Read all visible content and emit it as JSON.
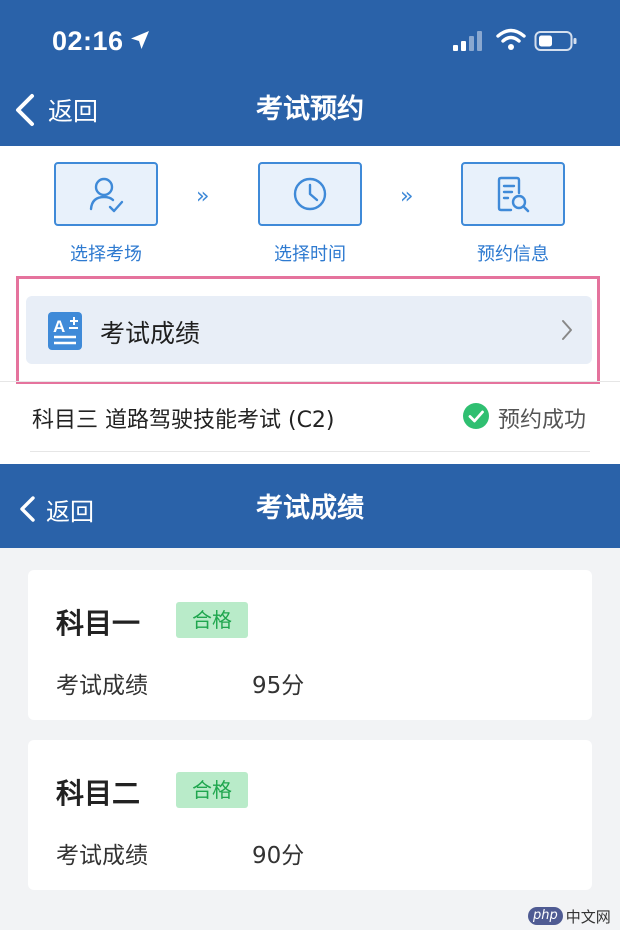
{
  "status_bar": {
    "time": "02:16"
  },
  "nav1": {
    "back_label": "返回",
    "title": "考试预约"
  },
  "steps": [
    {
      "label": "选择考场",
      "icon": "user-check-icon"
    },
    {
      "label": "选择时间",
      "icon": "clock-icon"
    },
    {
      "label": "预约信息",
      "icon": "document-search-icon"
    }
  ],
  "step_separator": "»",
  "score_entry": {
    "label": "考试成绩",
    "icon": "grade-a-plus-icon"
  },
  "exam": {
    "name": "科目三 道路驾驶技能考试 (C2)",
    "status": "预约成功"
  },
  "nav2": {
    "back_label": "返回",
    "title": "考试成绩"
  },
  "cards": [
    {
      "subject": "科目一",
      "badge": "合格",
      "score_label": "考试成绩",
      "score_value": "95分"
    },
    {
      "subject": "科目二",
      "badge": "合格",
      "score_label": "考试成绩",
      "score_value": "90分"
    }
  ],
  "watermark": {
    "php": "php",
    "site": "中文网"
  },
  "colors": {
    "header_blue": "#2a62a9",
    "step_blue": "#3f8ad8",
    "highlight_pink": "#e5739d",
    "pass_green": "#1fa64e",
    "pass_bg": "#b9ebc9",
    "success_check": "#2fbf71"
  }
}
